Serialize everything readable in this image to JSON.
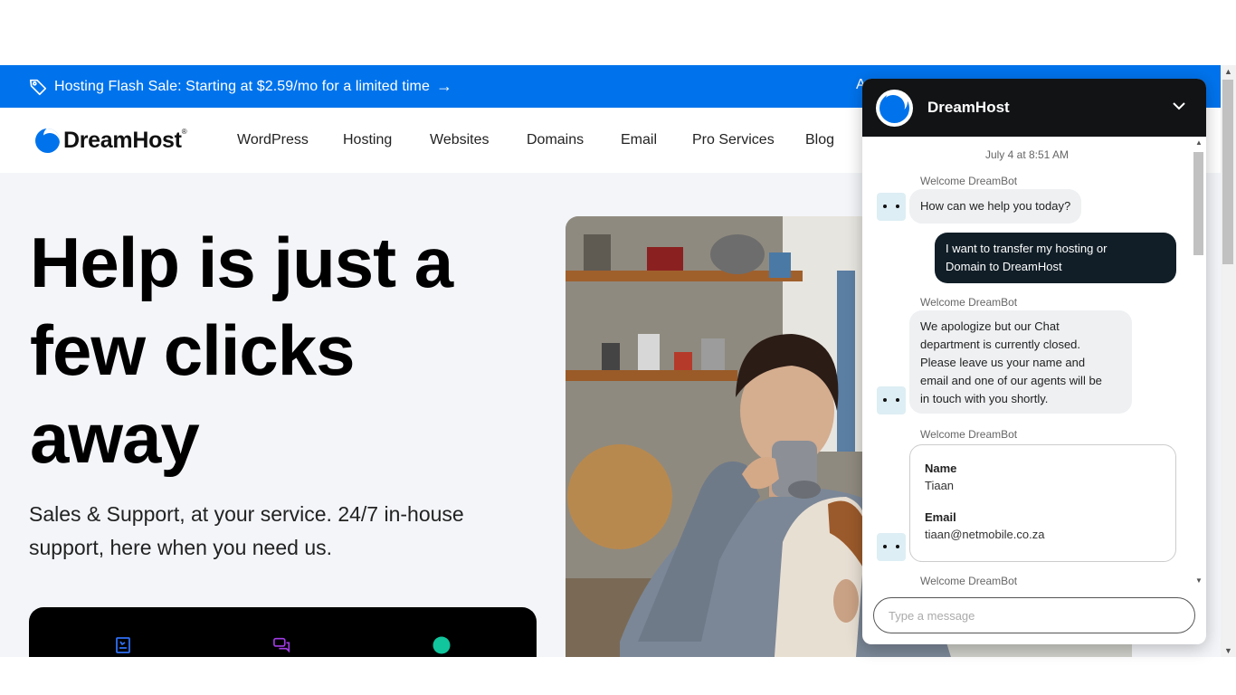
{
  "promo": {
    "text": "Hosting Flash Sale: Starting at $2.59/mo for a limited time",
    "arrow": "→",
    "right_fragment": "A",
    "icon": "tag-icon"
  },
  "nav": {
    "logo": "DreamHost",
    "logo_mark": "®",
    "items": [
      "WordPress",
      "Hosting",
      "Websites",
      "Domains",
      "Email",
      "Pro Services",
      "Blog"
    ]
  },
  "hero": {
    "title_lines": [
      "Help is just a",
      "few clicks",
      "away"
    ],
    "subtitle_lines": [
      "Sales & Support, at your service. 24/7 in-house",
      "support, here when you need us."
    ],
    "card_icons": [
      "book-icon",
      "chat-bubbles-icon",
      "status-dot-icon"
    ],
    "colors": {
      "book": "#2f6ff5",
      "chat": "#a23ce6",
      "dot": "#11c59d"
    }
  },
  "chat": {
    "title": "DreamHost",
    "timestamp": "July 4 at 8:51 AM",
    "messages": [
      {
        "sender": "Welcome DreamBot",
        "text": "How can we help you today?"
      },
      {
        "sender": "user",
        "lines": [
          "I want to transfer my hosting or",
          "Domain to DreamHost"
        ]
      },
      {
        "sender": "Welcome DreamBot",
        "lines": [
          "We apologize but our Chat",
          "department is currently closed.",
          "Please leave us your name and",
          "email and one of our agents will be",
          "in touch with you shortly."
        ]
      },
      {
        "sender": "Welcome DreamBot"
      },
      {
        "sender": "Welcome DreamBot"
      }
    ],
    "form": {
      "name_label": "Name",
      "name_value": "Tiaan",
      "email_label": "Email",
      "email_value": "tiaan@netmobile.co.za"
    },
    "input_placeholder": "Type a message"
  }
}
